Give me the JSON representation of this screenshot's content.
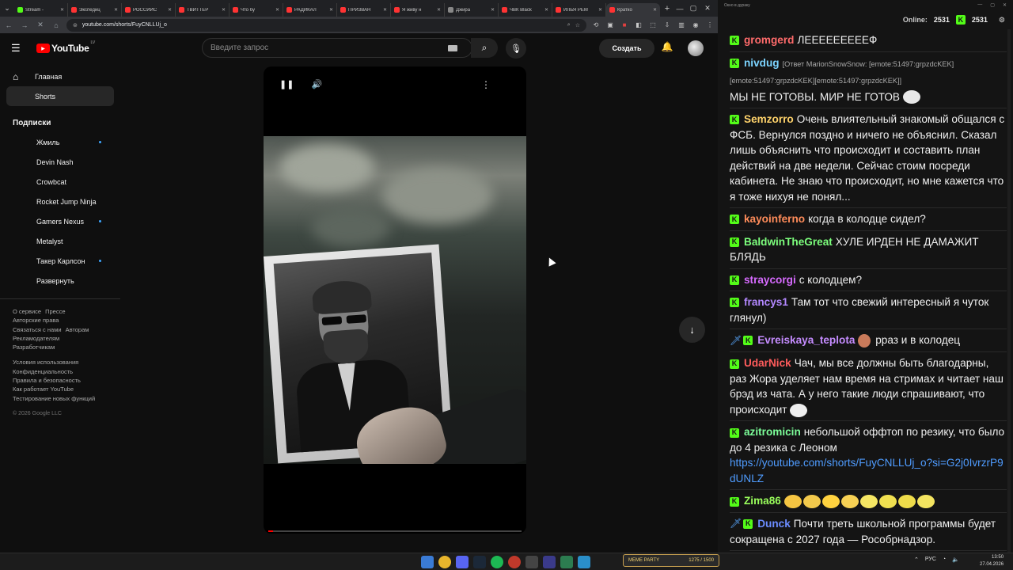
{
  "browser": {
    "tabs": [
      {
        "title": "Stream - ",
        "color": "#53fc18"
      },
      {
        "title": "Экспедиц",
        "color": "#ff3333"
      },
      {
        "title": "РОССИЙС",
        "color": "#ff3333"
      },
      {
        "title": "ТВИТТЕР",
        "color": "#ff3333"
      },
      {
        "title": "Что бу",
        "color": "#ff3333"
      },
      {
        "title": "РАДИКАЛ",
        "color": "#ff3333"
      },
      {
        "title": "ПРИЗВАН",
        "color": "#ff3333"
      },
      {
        "title": "Я живу н",
        "color": "#ff3333"
      },
      {
        "title": "Джира",
        "color": "#888888"
      },
      {
        "title": "ЧВК Black",
        "color": "#ff3333"
      },
      {
        "title": "ИЛЬЯ РЕМ",
        "color": "#ff3333"
      },
      {
        "title": "Кратко",
        "color": "#ff3333",
        "active": true
      }
    ],
    "url": "youtube.com/shorts/FuyCNLLUj_o"
  },
  "youtube": {
    "logo_text": "YouTube",
    "logo_country": "LV",
    "search_placeholder": "Введите запрос",
    "create_label": "Создать",
    "nav": [
      {
        "label": "Главная",
        "icon": "home-icon"
      },
      {
        "label": "Shorts",
        "icon": "shorts-icon",
        "selected": true
      }
    ],
    "subscriptions_title": "Подписки",
    "subscriptions": [
      {
        "name": "Жмиль",
        "new": true
      },
      {
        "name": "Devin Nash",
        "new": false
      },
      {
        "name": "Crowbcat",
        "new": false
      },
      {
        "name": "Rocket Jump Ninja",
        "new": false
      },
      {
        "name": "Gamers Nexus",
        "new": true
      },
      {
        "name": "Metalyst",
        "new": false
      },
      {
        "name": "Такер Карлсон",
        "new": true
      },
      {
        "name": "Развернуть",
        "new": false
      }
    ],
    "footer_links_1": [
      "О сервисе",
      "Прессе",
      "Авторские права",
      "Связаться с нами",
      "Авторам",
      "Рекламодателям",
      "Разработчикам"
    ],
    "footer_links_2": [
      "Условия использования",
      "Конфиденциальность",
      "Правила и безопасность",
      "Как работает YouTube",
      "Тестирование новых функций"
    ],
    "copyright": "© 2026 Google LLC",
    "short": {
      "progress": 0.02
    }
  },
  "chat": {
    "window_title": "Окно в дураку",
    "online_label": "Online:",
    "online_count": "2531",
    "kick_count": "2531",
    "messages": [
      {
        "user": "gromgerd",
        "color": "#ff6b6b",
        "text": "ЛЕЕЕЕЕЕЕЕЕФ"
      },
      {
        "user": "nivdug",
        "color": "#7cd4ff",
        "reply": "[Ответ MarionSnowSnow: [emote:51497:grpzdcKEK][emote:51497:grpzdcKEK][emote:51497:grpzdcKEK]]",
        "text": "МЫ НЕ ГОТОВЫ. МИР НЕ ГОТОВ"
      },
      {
        "user": "Semzorro",
        "color": "#ffd36b",
        "text": "Очень влиятельный знакомый общался с ФСБ. Вернулся поздно и ничего не объяснил. Сказал лишь объяснить что происходит и составить план действий на две недели. Сейчас стоим посреди кабинета. Не знаю что происходит, но мне кажется что я тоже нихуя не понял..."
      },
      {
        "user": "kayoinferno",
        "color": "#ff8c5a",
        "text": "когда в колодце сидел?"
      },
      {
        "user": "BaldwinTheGreat",
        "color": "#7dff7d",
        "text": "ХУЛЕ ИРДЕН НЕ ДАМАЖИТ БЛЯДЬ"
      },
      {
        "user": "straycorgi",
        "color": "#d76bff",
        "text": "с колодцем?"
      },
      {
        "user": "francys1",
        "color": "#b388ff",
        "text": "Там тот что свежий интересный я чуток глянул)"
      },
      {
        "user": "Evreiskaya_teplota",
        "color": "#c58cff",
        "text": "рраз и в колодец",
        "sword": true
      },
      {
        "user": "UdarNick",
        "color": "#ff5c5c",
        "text": "Чач, мы все должны быть благодарны, раз Жора уделяет нам время на стримах и читает наш брэд из чата. А у него такие люди спрашивают, что происходит"
      },
      {
        "user": "azitromicin",
        "color": "#7dff9a",
        "text": "небольшой оффтоп по резику, что было до 4 резика с Леоном",
        "link": "https://youtube.com/shorts/FuyCNLLUj_o?si=G2j0IvrzrP9dUNLZ"
      },
      {
        "user": "Zima86",
        "color": "#9aff5c",
        "text": ""
      },
      {
        "user": "Dunck",
        "color": "#6b8cff",
        "text": "Почти треть школьной программы будет сокращена с 2027 года — Рособрнадзор.",
        "sword": true
      }
    ]
  },
  "taskbar": {
    "meme_label": "MEME PARTY",
    "meme_count": "1275 / 1500",
    "lang": "РУС",
    "time": "13:50",
    "date": "27.04.2026"
  }
}
